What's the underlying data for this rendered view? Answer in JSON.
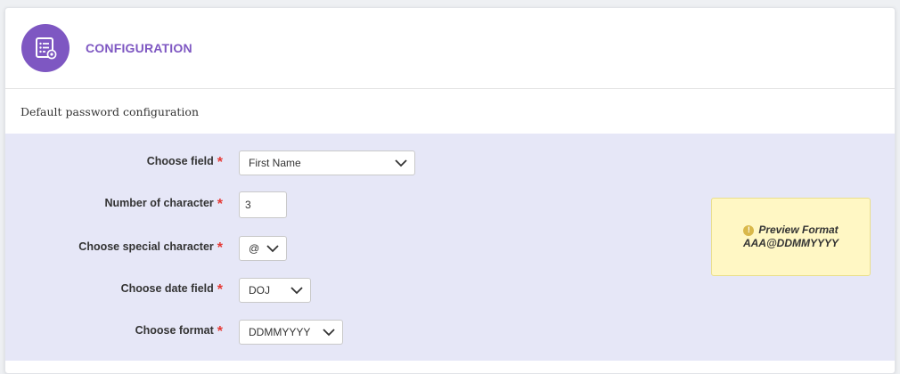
{
  "header": {
    "title": "CONFIGURATION",
    "icon": "settings-list-icon",
    "accent_color": "#7e57c2"
  },
  "section": {
    "title": "Default password configuration"
  },
  "form": {
    "required_mark": "*",
    "choose_field": {
      "label": "Choose field",
      "value": "First Name"
    },
    "number_of_character": {
      "label": "Number of character",
      "value": "3"
    },
    "special_character": {
      "label": "Choose special character",
      "value": "@"
    },
    "date_field": {
      "label": "Choose date field",
      "value": "DOJ"
    },
    "format": {
      "label": "Choose format",
      "value": "DDMMYYYY"
    }
  },
  "preview": {
    "icon": "info-icon",
    "title": "Preview Format",
    "value": "AAA@DDMMYYYY"
  }
}
